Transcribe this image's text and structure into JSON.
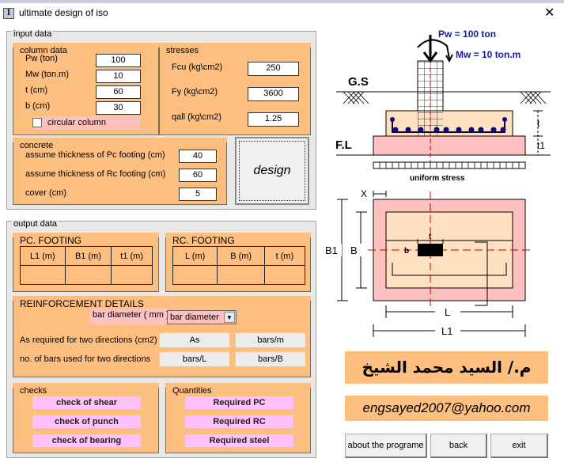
{
  "window": {
    "title": "ultimate design of iso",
    "icon_letter": "I",
    "close_glyph": "✕"
  },
  "input_data": {
    "label": "input data",
    "column_data": {
      "label": "column data",
      "fields": [
        {
          "label": "Pw (ton)",
          "value": "100"
        },
        {
          "label": "Mw (ton.m)",
          "value": "10"
        },
        {
          "label": "t  (cm)",
          "value": "60"
        },
        {
          "label": "b (cm)",
          "value": "30"
        }
      ],
      "circular_label": "circular column",
      "circular_checked": false
    },
    "stresses": {
      "label": "stresses",
      "fields": [
        {
          "label": "Fcu (kg\\cm2)",
          "value": "250"
        },
        {
          "label": "Fy (kg\\cm2)",
          "value": "3600"
        },
        {
          "label": "qall (kg\\cm2)",
          "value": "1.25"
        }
      ]
    },
    "concrete": {
      "label": "concrete",
      "fields": [
        {
          "label": "assume thickness of Pc footing (cm)",
          "value": "40"
        },
        {
          "label": "assume thickness of Rc footing  (cm)",
          "value": "60"
        },
        {
          "label": "cover (cm)",
          "value": "5"
        }
      ]
    },
    "design_button": "design"
  },
  "output_data": {
    "label": "output data",
    "pc_footing": {
      "label": "PC. FOOTING",
      "headers": [
        "L1 (m)",
        "B1 (m)",
        "t1 (m)"
      ],
      "values": [
        "",
        "",
        ""
      ]
    },
    "rc_footing": {
      "label": "RC. FOOTING",
      "headers": [
        "L (m)",
        "B (m)",
        "t (m)"
      ],
      "values": [
        "",
        "",
        ""
      ]
    },
    "reinforcement": {
      "label": "REINFORCEMENT DETAILS",
      "bar_diameter_label": "bar diameter ( mm )",
      "bar_diameter_selected": "bar diameter",
      "as_required_label": "As required for two directions (cm2)",
      "as_value": "As",
      "bars_m_value": "bars/m",
      "no_bars_label": "no. of bars used for two directions",
      "bars_l_value": "bars/L",
      "bars_b_value": "bars/B"
    },
    "checks": {
      "label": "checks",
      "buttons": [
        "check of shear",
        "check of punch",
        "check of bearing"
      ]
    },
    "quantities": {
      "label": "Quantities",
      "buttons": [
        "Required PC",
        "Required RC",
        "Required steel"
      ]
    }
  },
  "diagram": {
    "load_label": "Pw = 100 ton",
    "moment_label": "Mw = 10 ton.m",
    "gs_label": "G.S",
    "fl_label": "F.L",
    "t_label": "t",
    "t1_label": "t1",
    "stress_label": "uniform stress",
    "plan": {
      "x": "X",
      "b1": "B1",
      "b": "B",
      "col_b": "b",
      "col_t": "t",
      "l": "L",
      "l1": "L1"
    },
    "colors": {
      "pc": "#ffc0c0",
      "rc": "#ffe0c0",
      "load_text": "#1a1a9e",
      "axis": "#cc0000",
      "bars": "#0a0a80"
    }
  },
  "author": {
    "name_arabic": "م./ السيد محمد الشيخ",
    "email": "engsayed2007@yahoo.com"
  },
  "footer_buttons": {
    "about": "about the programe",
    "back": "back",
    "exit": "exit"
  }
}
